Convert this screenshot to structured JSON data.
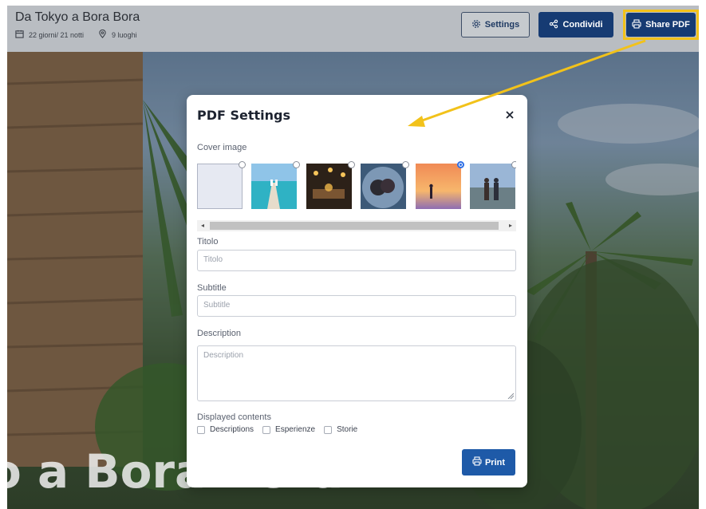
{
  "header": {
    "trip_title": "Da Tokyo a Bora Bora",
    "duration": "22 giorni/ 21 notti",
    "places": "9 luoghi",
    "settings_label": "Settings",
    "condividi_label": "Condividi",
    "share_pdf_label": "Share PDF"
  },
  "hero": {
    "title": "o a Bora Bora"
  },
  "modal": {
    "title": "PDF Settings",
    "cover_label": "Cover image",
    "cover_images": [
      {
        "name": "blank",
        "selected": false
      },
      {
        "name": "beach-pier-photo",
        "selected": false
      },
      {
        "name": "night-restaurant-photo",
        "selected": false
      },
      {
        "name": "couple-selfie-photo",
        "selected": false
      },
      {
        "name": "sunset-beach-photo",
        "selected": true
      },
      {
        "name": "couple-hiking-photo",
        "selected": false
      }
    ],
    "titolo_label": "Titolo",
    "titolo_placeholder": "Titolo",
    "subtitle_label": "Subtitle",
    "subtitle_placeholder": "Subtitle",
    "description_label": "Description",
    "description_placeholder": "Description",
    "displayed_label": "Displayed contents",
    "contents": [
      "Descriptions",
      "Esperienze",
      "Storie"
    ],
    "print_label": "Print"
  },
  "colors": {
    "primary": "#163b73",
    "highlight": "#f2c21a",
    "radio_selected": "#2f6fe4",
    "print": "#1e5aa8"
  }
}
